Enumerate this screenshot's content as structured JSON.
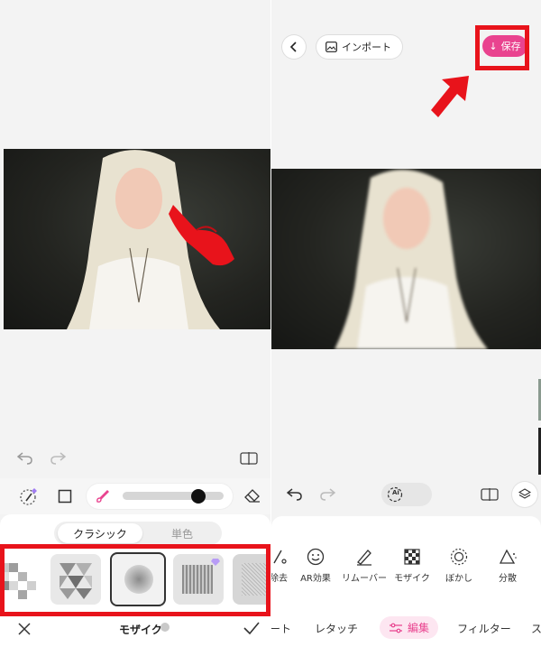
{
  "left": {
    "tool_tabs": {
      "classic": "クラシック",
      "single_color": "単色"
    },
    "mode_title": "モザイク",
    "icons": {
      "undo": "undo-icon",
      "redo": "redo-icon",
      "compare": "compare-icon",
      "brush": "magic-brush-icon",
      "square": "square-icon",
      "paint": "paint-brush-icon",
      "eraser": "eraser-icon",
      "close": "close-icon",
      "confirm": "check-icon"
    }
  },
  "right": {
    "import_label": "インポート",
    "save_label": "保存",
    "tools": [
      {
        "label": "除去",
        "icon": "remove-icon"
      },
      {
        "label": "AR効果",
        "icon": "smiley-icon"
      },
      {
        "label": "リムーバー",
        "icon": "eraser-pen-icon"
      },
      {
        "label": "モザイク",
        "icon": "mosaic-icon"
      },
      {
        "label": "ぼかし",
        "icon": "blur-icon"
      },
      {
        "label": "分散",
        "icon": "disperse-icon"
      }
    ],
    "nav_tabs": {
      "t1": "ート",
      "t2": "レタッチ",
      "t3": "編集",
      "t4": "フィルター",
      "t5": "ス"
    },
    "ai_badge": "Ai"
  },
  "colors": {
    "accent_pink": "#e9438f",
    "highlight_red": "#e8131b"
  }
}
